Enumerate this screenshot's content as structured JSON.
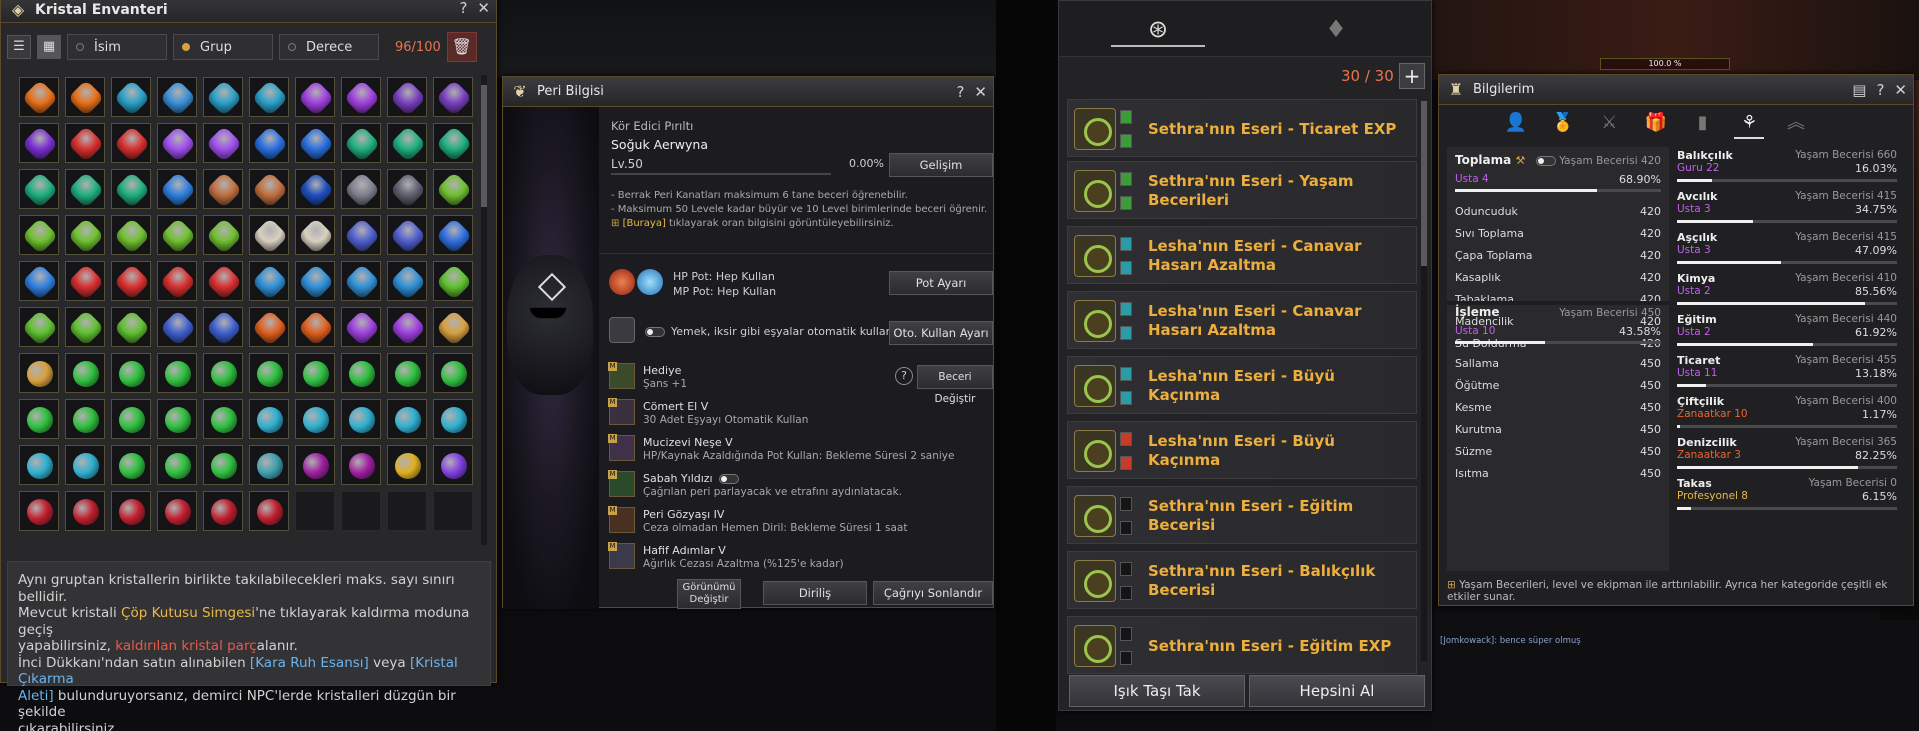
{
  "kristal": {
    "title": "Kristal Envanteri",
    "sort_options": [
      "İsim",
      "Grup",
      "Derece"
    ],
    "sort_selected": "Grup",
    "count": "96/100",
    "desc": {
      "l1": "Aynı gruptan kristallerin birlikte takılabilecekleri maks. sayı sınırı bellidir.",
      "l2a": "Mevcut kristali ",
      "l2b": "Çöp Kutusu Simgesi",
      "l2c": "'ne tıklayarak kaldırma moduna geçiş",
      "l3a": "yapabilirsiniz, ",
      "l3b": "kaldırılan kristal parç",
      "l3c": "alanır.",
      "l4a": "İnci Dükkanı'ndan satın alınabilen ",
      "l4b": "[Kara Ruh Esansı]",
      "l4c": " veya ",
      "l4d": "[Kristal Çıkarma",
      "l5a": "Aleti]",
      "l5b": " bulunduruyorsanız, demirci NPC'lerde kristalleri düzgün bir şekilde",
      "l6": "çıkarabilirsiniz."
    }
  },
  "peri": {
    "title": "Peri Bilgisi",
    "subtitle": "Kör Edici Pırıltı",
    "name": "Soğuk Aerwyna",
    "level": "Lv.50",
    "exp": "0.00%",
    "develop_btn": "Gelişim",
    "note1": "- Berrak Peri Kanatları maksimum 6 tane beceri öğrenebilir.",
    "note2": "- Maksimum 50 Levele kadar büyür ve 10 Level birimlerinde beceri öğrenir.",
    "note3a": "[Buraya]",
    "note3b": " tıklayarak oran bilgisini görüntüleyebilirsiniz.",
    "hp_pot": "HP Pot: Hep Kullan",
    "mp_pot": "MP Pot: Hep Kullan",
    "pot_btn": "Pot Ayarı",
    "auto_text": "Yemek, iksir gibi eşyalar otomatik kullanılır.",
    "auto_btn": "Oto. Kullan Ayarı",
    "change_skill_btn": "Beceri Değiştir",
    "skills": [
      {
        "name": "Hediye",
        "desc": "Şans +1"
      },
      {
        "name": "Cömert El V",
        "desc": "30 Adet Eşyayı Otomatik Kullan"
      },
      {
        "name": "Mucizevi Neşe V",
        "desc": "HP/Kaynak Azaldığında Pot Kullan: Bekleme Süresi 2 saniye"
      },
      {
        "name": "Sabah Yıldızı",
        "desc": "Çağrılan peri parlayacak ve etrafını aydınlatacak."
      },
      {
        "name": "Peri Gözyaşı IV",
        "desc": "Ceza olmadan Hemen Diril: Bekleme Süresi 1 saat"
      },
      {
        "name": "Hafif Adımlar V",
        "desc": "Ağırlık Cezası Azaltma (%125'e kadar)"
      }
    ],
    "btn_look1": "Görünümü",
    "btn_look2": "Değiştir",
    "btn_revive": "Diriliş",
    "btn_end": "Çağrıyı Sonlandır"
  },
  "eser": {
    "count": "30 / 30",
    "items": [
      {
        "label": "Sethra'nın Eseri - Ticaret EXP"
      },
      {
        "label": "Sethra'nın Eseri - Yaşam Becerileri"
      },
      {
        "label": "Lesha'nın Eseri - Canavar Hasarı Azaltma"
      },
      {
        "label": "Lesha'nın Eseri - Canavar Hasarı Azaltma"
      },
      {
        "label": "Lesha'nın Eseri - Büyü Kaçınma"
      },
      {
        "label": "Lesha'nın Eseri - Büyü Kaçınma"
      },
      {
        "label": "Sethra'nın Eseri - Eğitim Becerisi"
      },
      {
        "label": "Sethra'nın Eseri - Balıkçılık Becerisi"
      },
      {
        "label": "Sethra'nın Eseri - Eğitim EXP"
      }
    ],
    "btn_left": "Işık Taşı Tak",
    "btn_right": "Hepsini Al"
  },
  "bilgi": {
    "title": "Bilgilerim",
    "gathering": {
      "name": "Toplama",
      "skill": "Yaşam Becerisi 420",
      "rank": "Usta 4",
      "pct": "68.90%",
      "progress": 0.689,
      "subs": [
        {
          "name": "Oduncuduk",
          "val": "420"
        },
        {
          "name": "Sıvı Toplama",
          "val": "420"
        },
        {
          "name": "Çapa Toplama",
          "val": "420"
        },
        {
          "name": "Kasaplık",
          "val": "420"
        },
        {
          "name": "Tabaklama",
          "val": "420"
        },
        {
          "name": "Madencilik",
          "val": "420"
        },
        {
          "name": "Su Doldurma",
          "val": "420"
        }
      ]
    },
    "processing": {
      "name": "İşleme",
      "skill": "Yaşam Becerisi 450",
      "rank": "Usta 10",
      "pct": "43.58%",
      "progress": 0.4358,
      "subs": [
        {
          "name": "Sallama",
          "val": "450"
        },
        {
          "name": "Öğütme",
          "val": "450"
        },
        {
          "name": "Kesme",
          "val": "450"
        },
        {
          "name": "Kurutma",
          "val": "450"
        },
        {
          "name": "Süzme",
          "val": "450"
        },
        {
          "name": "Isıtma",
          "val": "450"
        }
      ]
    },
    "right": [
      {
        "name": "Balıkçılık",
        "skill": "Yaşam Becerisi 660",
        "rank": "Guru 22",
        "pct": "16.03%",
        "progress": 0.1603,
        "color": "#c060e8"
      },
      {
        "name": "Avcılık",
        "skill": "Yaşam Becerisi 415",
        "rank": "Usta 3",
        "pct": "34.75%",
        "progress": 0.3475,
        "color": "#c060e8"
      },
      {
        "name": "Aşçılık",
        "skill": "Yaşam Becerisi 415",
        "rank": "Usta 3",
        "pct": "47.09%",
        "progress": 0.4709,
        "color": "#c060e8"
      },
      {
        "name": "Kimya",
        "skill": "Yaşam Becerisi 410",
        "rank": "Usta 2",
        "pct": "85.56%",
        "progress": 0.8556,
        "color": "#c060e8"
      },
      {
        "name": "Eğitim",
        "skill": "Yaşam Becerisi 440",
        "rank": "Usta 2",
        "pct": "61.92%",
        "progress": 0.6192,
        "color": "#c060e8"
      },
      {
        "name": "Ticaret",
        "skill": "Yaşam Becerisi 455",
        "rank": "Usta 11",
        "pct": "13.18%",
        "progress": 0.1318,
        "color": "#c060e8"
      },
      {
        "name": "Çiftçilik",
        "skill": "Yaşam Becerisi 400",
        "rank": "Zanaatkar 10",
        "pct": "1.17%",
        "progress": 0.0117,
        "color": "#f06030"
      },
      {
        "name": "Denizcilik",
        "skill": "Yaşam Becerisi 365",
        "rank": "Zanaatkar 3",
        "pct": "82.25%",
        "progress": 0.8225,
        "color": "#f06030"
      },
      {
        "name": "Takas",
        "skill": "Yaşam Becerisi 0",
        "rank": "Profesyonel 8",
        "pct": "6.15%",
        "progress": 0.0615,
        "color": "#e9b84a"
      }
    ],
    "footer": "Yaşam Becerileri, level ve ekipman ile arttırılabilir. Ayrıca her kategoride çeşitli ek etkiler sunar."
  },
  "chat": "[Jomkowack]: bence süper olmuş",
  "hpbar": "100.0 %"
}
